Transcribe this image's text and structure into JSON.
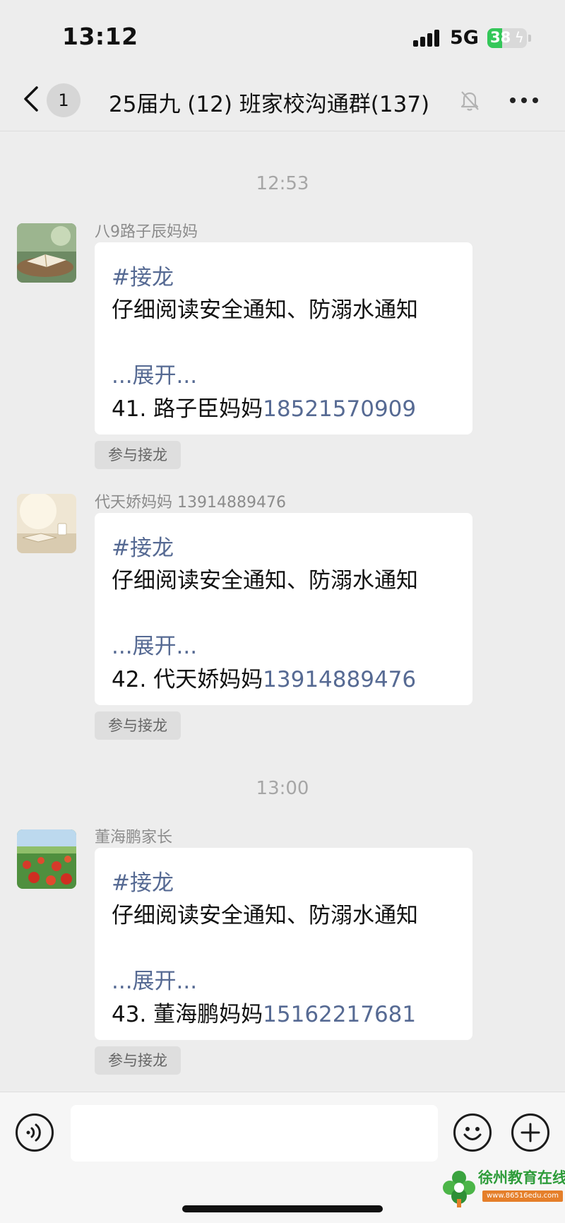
{
  "status": {
    "time": "13:12",
    "network": "5G",
    "battery": "38",
    "battery_level": 0.38,
    "battery_color": "#34c759"
  },
  "nav": {
    "back_icon": "chevron-left-icon",
    "unread_count": "1",
    "title": "25届九 (12) 班家校沟通群(137)",
    "mute_icon": "bell-slash-icon",
    "more_icon": "more-horizontal-icon"
  },
  "timestamps": [
    "12:53",
    "13:00"
  ],
  "messages": [
    {
      "sender": "八9路子辰妈妈",
      "tag": "#接龙",
      "text": "仔细阅读安全通知、防溺水通知",
      "expand": "...展开...",
      "entry_prefix": "41. 路子臣妈妈",
      "entry_phone": "18521570909",
      "join_label": "参与接龙"
    },
    {
      "sender": "代天娇妈妈 13914889476",
      "tag": "#接龙",
      "text": "仔细阅读安全通知、防溺水通知",
      "expand": "...展开...",
      "entry_prefix": "42. 代天娇妈妈",
      "entry_phone": "13914889476",
      "join_label": "参与接龙"
    },
    {
      "sender": "董海鹏家长",
      "tag": "#接龙",
      "text": "仔细阅读安全通知、防溺水通知",
      "expand": "...展开...",
      "entry_prefix": "43. 董海鹏妈妈",
      "entry_phone": "15162217681",
      "join_label": "参与接龙"
    }
  ],
  "input_bar": {
    "voice_icon": "voice-icon",
    "emoji_icon": "emoji-icon",
    "plus_icon": "plus-icon"
  },
  "watermark": {
    "name": "徐州教育在线",
    "url": "www.86516edu.com"
  },
  "colors": {
    "link": "#566a93",
    "background": "#ededed"
  }
}
